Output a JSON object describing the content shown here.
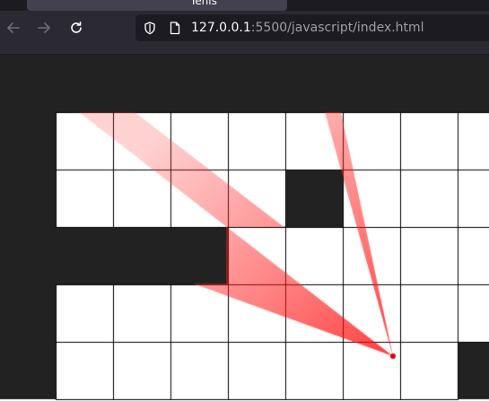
{
  "browser": {
    "tab_title": "Ténis",
    "url_host": "127.0.0.1",
    "url_rest": ":5500/javascript/index.html"
  },
  "icons": {
    "back": "arrow-left-icon",
    "forward": "arrow-right-icon",
    "reload": "reload-icon",
    "tracking_protection": "shield-icon",
    "page_info": "page-icon"
  },
  "game": {
    "grid_columns": 8,
    "grid_rows": 6,
    "cells": [
      [
        1,
        1,
        1,
        1,
        1,
        1,
        1,
        1,
        1
      ],
      [
        1,
        0,
        0,
        0,
        0,
        0,
        0,
        0,
        0
      ],
      [
        1,
        0,
        0,
        0,
        0,
        1,
        0,
        0,
        0
      ],
      [
        1,
        1,
        1,
        1,
        0,
        0,
        0,
        0,
        0
      ],
      [
        1,
        0,
        0,
        0,
        0,
        0,
        0,
        0,
        0
      ],
      [
        1,
        0,
        0,
        0,
        0,
        0,
        0,
        0,
        1
      ]
    ],
    "colors": {
      "wall": "#222222",
      "floor": "#ffffff",
      "grid_line": "#000000",
      "ray": "#ff0000",
      "player": "#e00000"
    }
  }
}
